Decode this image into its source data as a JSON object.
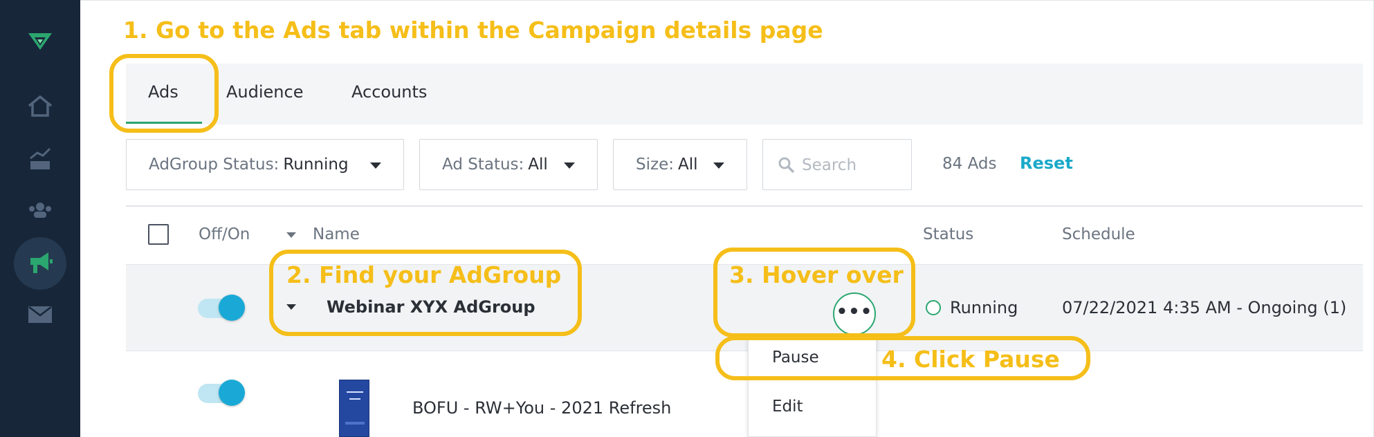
{
  "colors": {
    "annotation": "#f5be19",
    "accent_green": "#2ba66f",
    "link_blue": "#1aa9c9",
    "sidebar_bg": "#18263a"
  },
  "sidebar": {
    "icons": [
      "logo-icon",
      "home-icon",
      "analytics-icon",
      "audience-icon",
      "campaigns-megaphone-icon",
      "mail-icon"
    ]
  },
  "annotations": {
    "step1": "1. Go to the Ads tab within the Campaign details page",
    "step2": "2. Find your AdGroup",
    "step3": "3. Hover over",
    "step4": "4. Click Pause"
  },
  "tabs": [
    {
      "label": "Ads",
      "active": true
    },
    {
      "label": "Audience",
      "active": false
    },
    {
      "label": "Accounts",
      "active": false
    }
  ],
  "filters": {
    "adgroup_status": {
      "label": "AdGroup Status:",
      "value": "Running"
    },
    "ad_status": {
      "label": "Ad Status:",
      "value": "All"
    },
    "size": {
      "label": "Size:",
      "value": "All"
    },
    "search_placeholder": "Search",
    "count": "84 Ads",
    "reset": "Reset"
  },
  "table": {
    "headers": {
      "off_on": "Off/On",
      "name": "Name",
      "status": "Status",
      "schedule": "Schedule"
    },
    "adgroup_row": {
      "name": "Webinar XYX AdGroup",
      "more": "•••",
      "status": "Running",
      "schedule": "07/22/2021 4:35 AM - Ongoing (1)",
      "enabled": true
    },
    "ad_row": {
      "name": "BOFU - RW+You - 2021 Refresh",
      "enabled": true
    }
  },
  "menu": {
    "items": [
      "Pause",
      "Edit"
    ]
  }
}
